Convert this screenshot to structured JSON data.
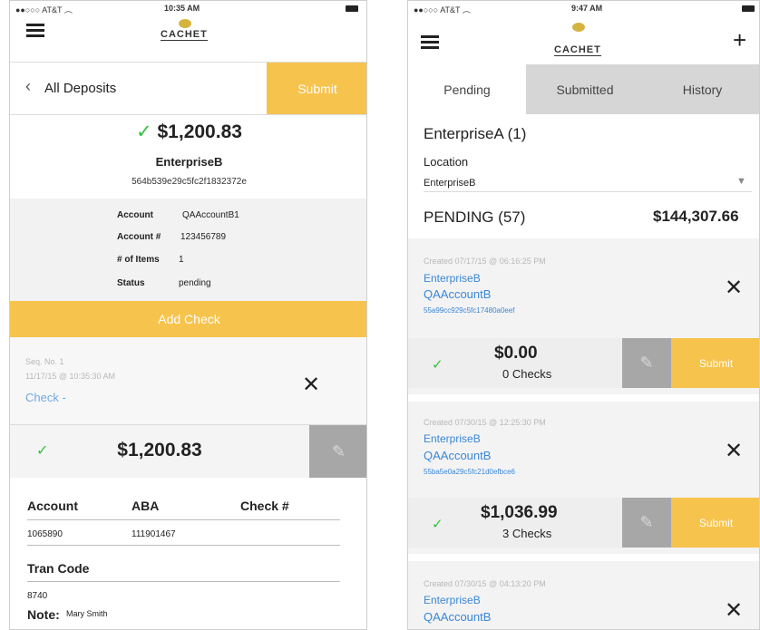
{
  "left": {
    "status": {
      "carrier": "AT&T",
      "time": "10:35 AM"
    },
    "logo": "CACHET",
    "nav": {
      "back_label": "All Deposits",
      "submit_label": "Submit"
    },
    "summary": {
      "check": "✓",
      "amount": "$1,200.83",
      "enterprise": "EnterpriseB",
      "id": "564b539e29c5fc2f1832372e"
    },
    "details": [
      {
        "label": "Account",
        "value": "QAAccountB1"
      },
      {
        "label": "Account #",
        "value": "123456789"
      },
      {
        "label": "# of Items",
        "value": "1"
      },
      {
        "label": "Status",
        "value": "pending"
      }
    ],
    "add_check_label": "Add Check",
    "seq": {
      "label": "Seq. No. 1",
      "datetime": "11/17/15 @ 10:35:30 AM",
      "link": "Check -"
    },
    "check_amount": "$1,200.83",
    "fields": {
      "account_label": "Account",
      "aba_label": "ABA",
      "check_no_label": "Check #",
      "account_value": "1065890",
      "aba_value": "111901467",
      "tran_code_label": "Tran Code",
      "tran_code_value": "8740",
      "note_label": "Note:",
      "note_value": "Mary Smith"
    }
  },
  "right": {
    "status": {
      "carrier": "AT&T",
      "time": "9:47 AM"
    },
    "logo": "CACHET",
    "plus": "+",
    "tabs": [
      "Pending",
      "Submitted",
      "History"
    ],
    "enterprise_title": "EnterpriseA (1)",
    "location_label": "Location",
    "location_value": "EnterpriseB",
    "pending_label": "PENDING (57)",
    "pending_total": "$144,307.66",
    "cards": [
      {
        "created": "Created 07/17/15 @ 06:16:25 PM",
        "enterprise": "EnterpriseB",
        "account": "QAAccountB",
        "id": "55a99cc929c5fc17480a0eef",
        "amount": "$0.00",
        "checks": "0 Checks",
        "submit": "Submit"
      },
      {
        "created": "Created 07/30/15 @ 12:25:30 PM",
        "enterprise": "EnterpriseB",
        "account": "QAAccountB",
        "id": "55ba5e0a29c5fc21d0efbce6",
        "amount": "$1,036.99",
        "checks": "3 Checks",
        "submit": "Submit"
      },
      {
        "created": "Created 07/30/15 @ 04:13:20 PM",
        "enterprise": "EnterpriseB",
        "account": "QAAccountB"
      }
    ]
  }
}
